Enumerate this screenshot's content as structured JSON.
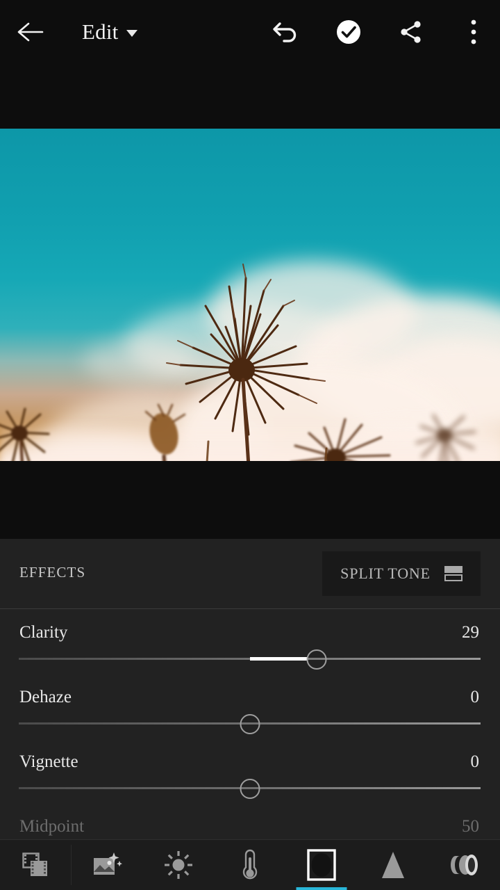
{
  "app": {
    "screen_title": "Edit",
    "accent_color": "#29b6d8",
    "panel_bg": "#222222",
    "bar_bg": "#1c1c1c"
  },
  "topbar": {
    "back_icon": "arrow-left-icon",
    "title": "Edit",
    "title_caret_icon": "chevron-down-icon",
    "actions": [
      {
        "name": "undo-button",
        "icon": "undo-arrow-icon",
        "label": "Undo"
      },
      {
        "name": "done-button",
        "icon": "check-circle-icon",
        "label": "Done"
      },
      {
        "name": "share-button",
        "icon": "share-icon",
        "label": "Share"
      },
      {
        "name": "overflow-button",
        "icon": "more-vertical-icon",
        "label": "More options"
      }
    ]
  },
  "photo": {
    "alt": "Dried thistle seed heads in a field against a teal sky with white clouds, split-toned orange highlights",
    "sky_color": "#11a0b0",
    "field_color": "#b4701c",
    "cloud_color": "#fdf2ea"
  },
  "panel": {
    "section_title": "EFFECTS",
    "split_tone": {
      "label": "SPLIT TONE",
      "icon": "split-tone-icon"
    },
    "sliders": [
      {
        "name": "clarity",
        "label": "Clarity",
        "value": "29",
        "numeric": 29,
        "min": -100,
        "max": 100,
        "thumb_pct": 64.5,
        "fill_from_pct": 50,
        "dimmed": false
      },
      {
        "name": "dehaze",
        "label": "Dehaze",
        "value": "0",
        "numeric": 0,
        "min": -100,
        "max": 100,
        "thumb_pct": 50,
        "fill_from_pct": 50,
        "dimmed": false
      },
      {
        "name": "vignette",
        "label": "Vignette",
        "value": "0",
        "numeric": 0,
        "min": -100,
        "max": 100,
        "thumb_pct": 50,
        "fill_from_pct": 50,
        "dimmed": false
      },
      {
        "name": "midpoint",
        "label": "Midpoint",
        "value": "50",
        "numeric": 50,
        "min": 0,
        "max": 100,
        "thumb_pct": 50,
        "fill_from_pct": 50,
        "dimmed": true
      }
    ]
  },
  "bottombar": {
    "items": [
      {
        "name": "tab-presets",
        "icon": "presets-stack-icon",
        "label": "Presets",
        "active": false
      },
      {
        "name": "tab-auto",
        "icon": "auto-enhance-icon",
        "label": "Auto",
        "active": false
      },
      {
        "name": "tab-light",
        "icon": "sun-icon",
        "label": "Light",
        "active": false
      },
      {
        "name": "tab-color",
        "icon": "thermometer-icon",
        "label": "Color",
        "active": false
      },
      {
        "name": "tab-effects",
        "icon": "effects-vignette-icon",
        "label": "Effects",
        "active": true
      },
      {
        "name": "tab-detail",
        "icon": "triangle-detail-icon",
        "label": "Detail",
        "active": false
      },
      {
        "name": "tab-optics",
        "icon": "lens-optics-icon",
        "label": "Optics",
        "active": false
      }
    ]
  }
}
